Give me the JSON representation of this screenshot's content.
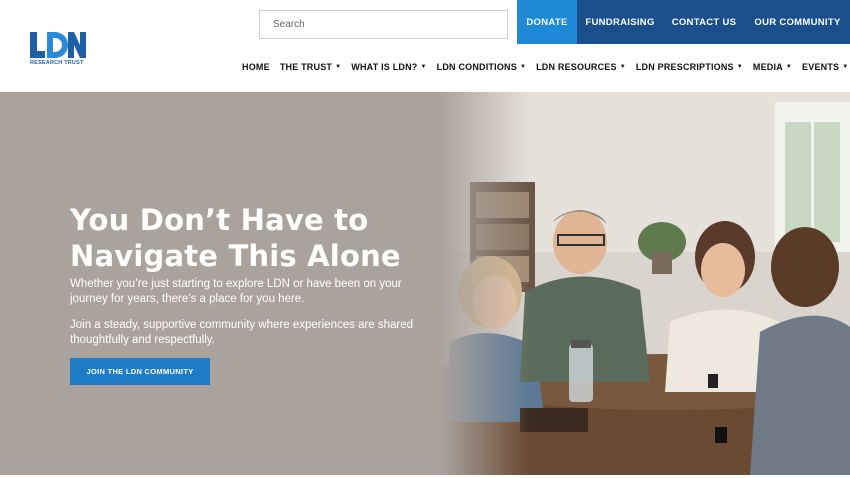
{
  "logo": {
    "mark_text": "LDN",
    "subtitle": "RESEARCH TRUST",
    "colors": {
      "primary": "#1f5fa6",
      "accent": "#2a8ad6"
    }
  },
  "search": {
    "placeholder": "Search",
    "value": ""
  },
  "top_bar": {
    "donate": "DONATE",
    "fundraising": "FUNDRAISING",
    "contact": "CONTACT US",
    "community": "OUR COMMUNITY"
  },
  "nav": {
    "items": [
      {
        "label": "HOME",
        "has_dropdown": false
      },
      {
        "label": "THE TRUST",
        "has_dropdown": true
      },
      {
        "label": "WHAT IS LDN?",
        "has_dropdown": true
      },
      {
        "label": "LDN CONDITIONS",
        "has_dropdown": true
      },
      {
        "label": "LDN RESOURCES",
        "has_dropdown": true
      },
      {
        "label": "LDN PRESCRIPTIONS",
        "has_dropdown": true
      },
      {
        "label": "MEDIA",
        "has_dropdown": true
      },
      {
        "label": "EVENTS",
        "has_dropdown": true
      }
    ]
  },
  "hero": {
    "title_line1": "You Don’t Have to",
    "title_line2": "Navigate This Alone",
    "paragraph1": "Whether you’re just starting to explore LDN or have been on your journey for years, there’s a place for you here.",
    "paragraph2": "Join a steady, supportive community where experiences are shared thoughtfully and respectfully.",
    "cta": "JOIN THE LDN COMMUNITY",
    "image_subject": "group-of-people-talking-at-table"
  },
  "colors": {
    "top_bar": "#1b4f8c",
    "donate": "#1e8ad6",
    "cta": "#1e7cc7",
    "hero_bg": "#aaa39d"
  }
}
